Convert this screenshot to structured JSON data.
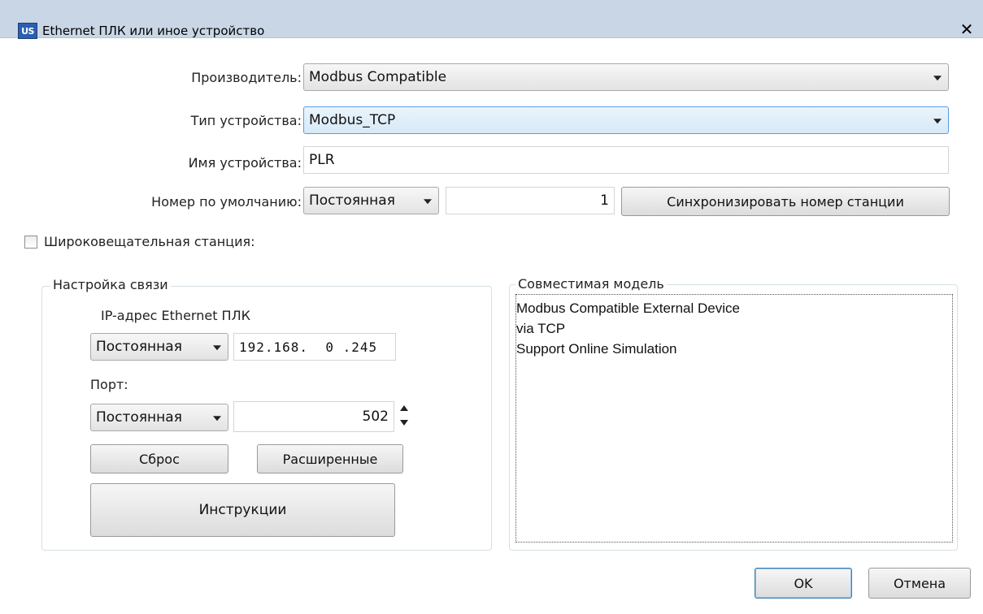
{
  "window": {
    "title": "Ethernet ПЛК или иное устройство",
    "app_icon_text": "US",
    "close_glyph": "✕"
  },
  "form": {
    "manufacturer_label": "Производитель:",
    "manufacturer_value": "Modbus Compatible",
    "device_type_label": "Тип устройства:",
    "device_type_value": "Modbus_TCP",
    "device_name_label": "Имя устройства:",
    "device_name_value": "PLR",
    "default_number_label": "Номер по умолчанию:",
    "default_number_mode": "Постоянная",
    "default_number_value": "1",
    "sync_button": "Синхронизировать номер станции",
    "broadcast_label": "Широковещательная станция:",
    "broadcast_checked": false
  },
  "comm": {
    "group_title": "Настройка связи",
    "ip_label": "IP-адрес Ethernet ПЛК",
    "ip_mode": "Постоянная",
    "ip_value": "192.168.  0 .245",
    "port_label": "Порт:",
    "port_mode": "Постоянная",
    "port_value": "502",
    "reset_button": "Сброс",
    "advanced_button": "Расширенные",
    "instructions_button": "Инструкции"
  },
  "compat": {
    "group_title": "Совместимая модель",
    "items": [
      "Modbus Compatible External Device",
      "via TCP",
      "Support Online Simulation"
    ]
  },
  "footer": {
    "ok_button": "OK",
    "cancel_button": "Отмена"
  },
  "icons": [
    "app-icon",
    "close-icon",
    "dropdown-arrow-icon",
    "spinner-up-icon",
    "spinner-down-icon",
    "checkbox-icon"
  ],
  "colors": {
    "titlebar": "#c9d6e6",
    "focus_border": "#569de5",
    "default_button_border": "#3c7fb1"
  }
}
